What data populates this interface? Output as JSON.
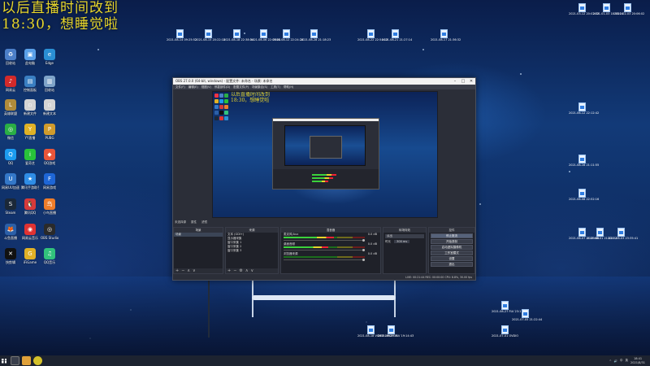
{
  "overlay": {
    "line1": "以后直播时间改到",
    "line2": "18:30，想睡觉啦"
  },
  "left_icons": [
    {
      "label": "回收站",
      "color": "#4c7fc9",
      "glyph": "♻"
    },
    {
      "label": "此电脑",
      "color": "#5aa0e8",
      "glyph": "▣"
    },
    {
      "label": "Edge",
      "color": "#2a8fd4",
      "glyph": "e"
    },
    {
      "label": "网易云",
      "color": "#d32a2a",
      "glyph": "♪"
    },
    {
      "label": "控制面板",
      "color": "#3a7fc2",
      "glyph": "▤"
    },
    {
      "label": "回收站",
      "color": "#7fa4c9",
      "glyph": "▥"
    },
    {
      "label": "英雄联盟",
      "color": "#b08b3a",
      "glyph": "L"
    },
    {
      "label": "新建文件",
      "color": "#d4d4d4",
      "glyph": "▫"
    },
    {
      "label": "新建文本",
      "color": "#d4d4d4",
      "glyph": "▫"
    },
    {
      "label": "微信",
      "color": "#2aae45",
      "glyph": "◎"
    },
    {
      "label": "YY直播",
      "color": "#e0b126",
      "glyph": "Y"
    },
    {
      "label": "PUBG",
      "color": "#d09b2c",
      "glyph": "P"
    },
    {
      "label": "QQ",
      "color": "#1c9bef",
      "glyph": "Q"
    },
    {
      "label": "爱奇艺",
      "color": "#28c23a",
      "glyph": "i"
    },
    {
      "label": "QQ游戏",
      "color": "#e8553a",
      "glyph": "◆"
    },
    {
      "label": "网易UU加速器",
      "color": "#3478c8",
      "glyph": "U"
    },
    {
      "label": "腾讯手游助手",
      "color": "#2f8de6",
      "glyph": "★"
    },
    {
      "label": "网易游戏",
      "color": "#1e66d6",
      "glyph": "F"
    },
    {
      "label": "Steam",
      "color": "#1b2838",
      "glyph": "S"
    },
    {
      "label": "腾讯QQ",
      "color": "#d63a3a",
      "glyph": "🐧"
    },
    {
      "label": "小鸟直播",
      "color": "#ef7d2a",
      "glyph": "鸟"
    },
    {
      "label": "斗鱼直播",
      "color": "#2b5fa8",
      "glyph": "🦊"
    },
    {
      "label": "网易云音乐",
      "color": "#e03232",
      "glyph": "◉"
    },
    {
      "label": "OBS Studio",
      "color": "#2a2a2a",
      "glyph": "◎"
    },
    {
      "label": "快剪辑",
      "color": "#111111",
      "glyph": "✕"
    },
    {
      "label": "iFiGame",
      "color": "#e0b126",
      "glyph": "G"
    },
    {
      "label": "QQ音乐",
      "color": "#31c27c",
      "glyph": "♫"
    }
  ],
  "top_files": [
    "2021-08-14 09:25:52",
    "2021-08-15 20:22:10",
    "2021-08-18 22:38:54",
    "2021-08-06 22:09:08",
    "2021-08-12 22:24:24",
    "2021-08-28 21:18:23",
    "2021-08-22 22:54:13",
    "2021-08-21 21:27:14",
    "2021-08-17 21:36:32"
  ],
  "tr_files": [
    "2021-03-12 20:02:33",
    "2021-01-03 18:58:20",
    "2021-02-03 20:06:02"
  ],
  "right_files": [
    "2021-06-12 22:12:42",
    "2021-08-16 21:11:55",
    "2021-06-08 22:52:16",
    "2021-06-07 21:29:40",
    "2021-06-01 21:22:22",
    "2021-08-03 23:35:41"
  ],
  "bottom_files": [
    "2021-08-27 FLV 23:17:42",
    "2021-07-05 21:22:44",
    "2021-08-18 VIDEO 19:09:14",
    "2021-08-27 FLV 19:14:43",
    "2021-07-01 OVDIO"
  ],
  "obs": {
    "title": "OBS 27.0.0 (64-bit, windows) - 配置文件: 未命名 - 场景: 未命名",
    "menu": [
      "文件(F)",
      "编辑(E)",
      "视图(V)",
      "停靠部件(D)",
      "配置文件(P)",
      "场景集合(S)",
      "工具(T)",
      "帮助(H)"
    ],
    "preview_overlay": [
      "以后直播时间改到",
      "18:30，想睡觉啦"
    ],
    "scenebar": [
      "未选择源",
      "属性",
      "滤镜"
    ],
    "docks": {
      "scenes": {
        "title": "场景",
        "items": [
          "场景"
        ]
      },
      "sources": {
        "title": "来源",
        "items": [
          "文本 (GDI+)",
          "显示器采集",
          "窗口采集 1",
          "窗口采集 2",
          "窗口采集 3"
        ]
      },
      "mixer": {
        "title": "混音器",
        "channels": [
          {
            "name": "麦克风/Aux",
            "db": "0.0 dB",
            "level": 0.62
          },
          {
            "name": "桌面音频",
            "db": "0.0 dB",
            "level": 0.55
          },
          {
            "name": "浏览器来源",
            "db": "0.0 dB",
            "level": 0.0
          }
        ]
      },
      "transitions": {
        "title": "转场特效",
        "type": "淡出",
        "duration_label": "时长",
        "duration": "300 ms"
      },
      "controls": {
        "title": "控件",
        "buttons": [
          "停止推流",
          "开始录制",
          "启动虚拟摄像机",
          "工作室模式",
          "设置",
          "退出"
        ]
      }
    },
    "status": "LIVE: 00:21:44   REC: 00:00:00   CPU: 8.8%, 30.00 fps"
  },
  "taskbar": {
    "time": "18:41",
    "date": "2021/8/31",
    "tray": [
      "^",
      "🔊",
      "中",
      "英"
    ]
  }
}
